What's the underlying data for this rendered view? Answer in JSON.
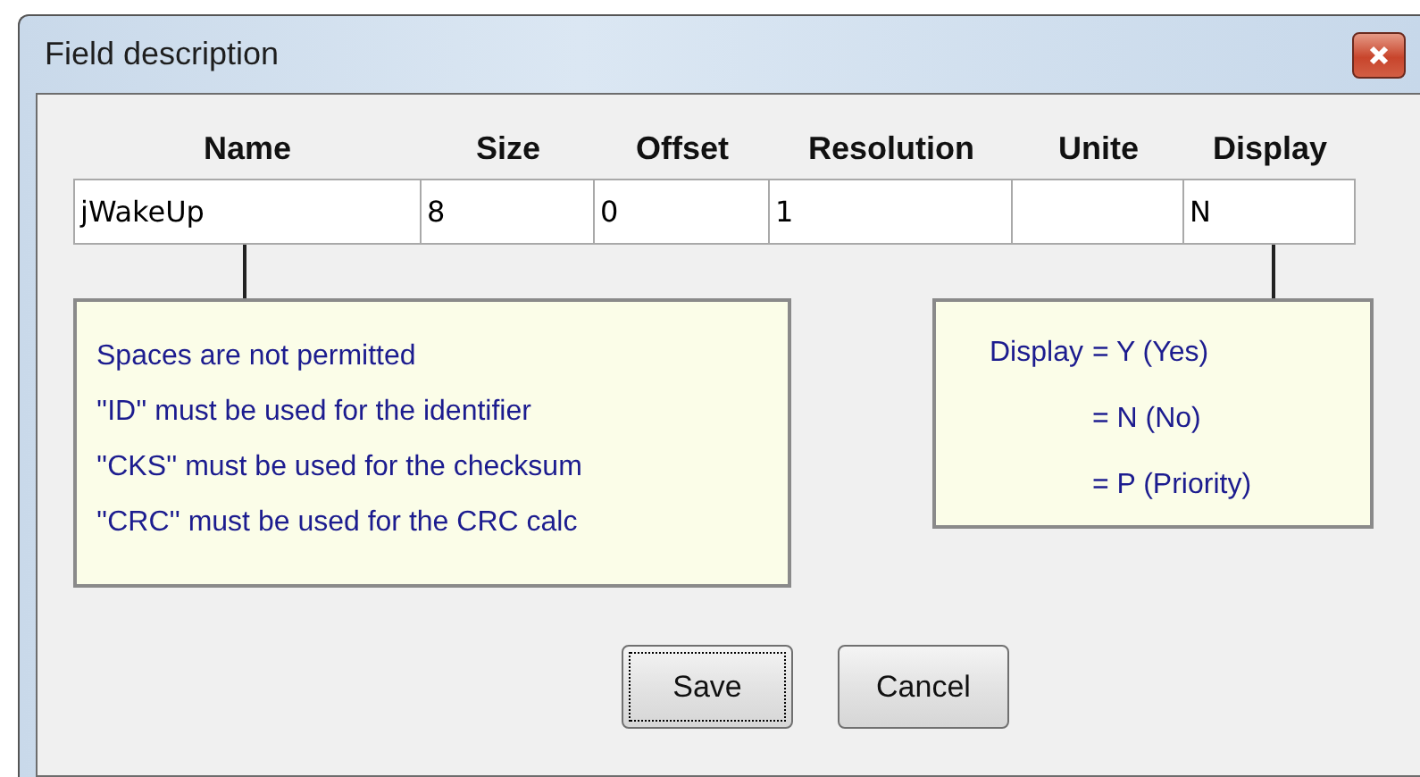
{
  "window": {
    "title": "Field description"
  },
  "table": {
    "columns": [
      {
        "header": "Name",
        "value": "jWakeUp"
      },
      {
        "header": "Size",
        "value": "8"
      },
      {
        "header": "Offset",
        "value": "0"
      },
      {
        "header": "Resolution",
        "value": "1"
      },
      {
        "header": "Unite"
      },
      {
        "header": "Display",
        "value": "N"
      }
    ]
  },
  "notes": [
    {
      "lines": [
        {
          "text": "Spaces are not permitted"
        },
        {
          "text": "''ID'' must be used for the identifier"
        },
        {
          "text": "''CKS'' must be used for the checksum"
        },
        {
          "text": "''CRC'' must be used for the CRC calc"
        }
      ]
    },
    {
      "lines": [
        {
          "label": "Display",
          "text": "= Y (Yes)"
        },
        {
          "text": "= N (No)"
        },
        {
          "text": "= P (Priority)"
        }
      ]
    }
  ],
  "buttons": [
    {
      "label": "Save",
      "focused": true
    },
    {
      "label": "Cancel",
      "focused": false
    }
  ]
}
